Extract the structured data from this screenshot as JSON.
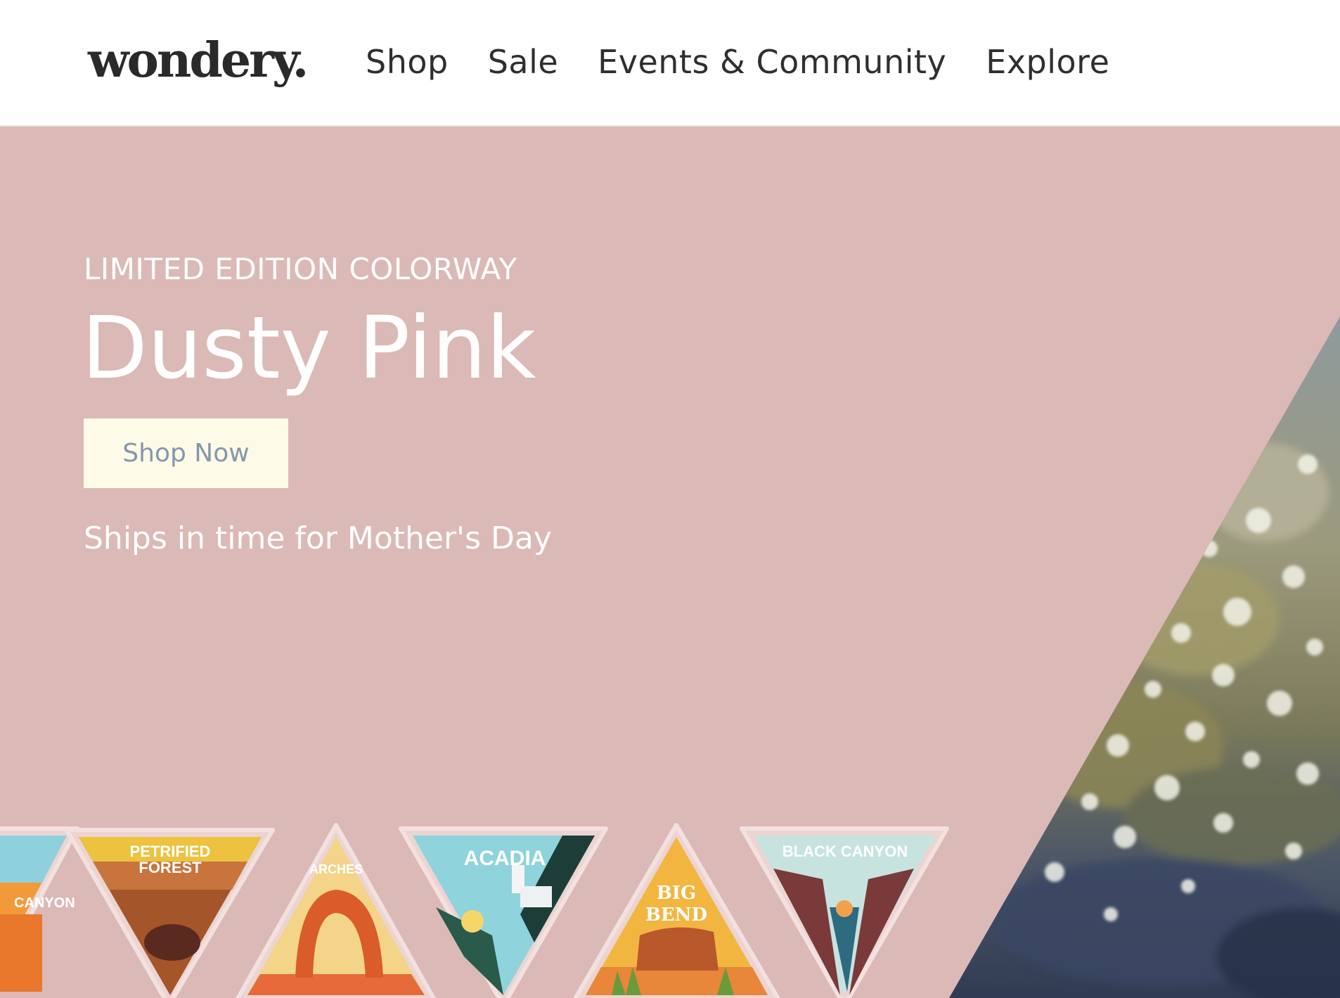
{
  "brand": {
    "logo_text": "wondery."
  },
  "nav": {
    "items": [
      {
        "label": "Shop"
      },
      {
        "label": "Sale"
      },
      {
        "label": "Events & Community"
      },
      {
        "label": "Explore"
      }
    ]
  },
  "hero": {
    "eyebrow": "LIMITED EDITION COLORWAY",
    "headline": "Dusty Pink",
    "cta_label": "Shop Now",
    "subtext": "Ships in time for Mother's Day",
    "background_color": "#dbb9b7",
    "cta_background": "#fdfae8",
    "cta_text_color": "#8597ab"
  },
  "patches": {
    "items": [
      {
        "label": "CANYON"
      },
      {
        "label_line1": "PETRIFIED",
        "label_line2": "FOREST"
      },
      {
        "label": "ARCHES"
      },
      {
        "label": "ACADIA"
      },
      {
        "label_line1": "BIG",
        "label_line2": "BEND"
      },
      {
        "label": "BLACK CANYON"
      }
    ]
  }
}
